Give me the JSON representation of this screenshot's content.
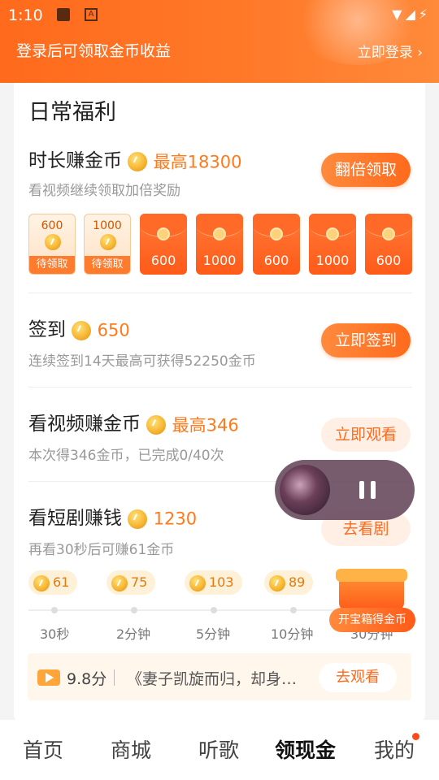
{
  "status_bar": {
    "time": "1:10",
    "icons": "▼◢⚡"
  },
  "header": {
    "login_prompt": "登录后可领取金币收益",
    "login_button": "立即登录 ›"
  },
  "daily": {
    "title": "日常福利",
    "duration": {
      "title": "时长赚金币",
      "max": "最高18300",
      "desc": "看视频继续领取加倍奖励",
      "button": "翻倍领取",
      "envelopes": [
        {
          "amount": "600",
          "state": "待领取"
        },
        {
          "amount": "1000",
          "state": "待领取"
        },
        {
          "amount": "600"
        },
        {
          "amount": "1000"
        },
        {
          "amount": "600"
        },
        {
          "amount": "1000"
        },
        {
          "amount": "600"
        }
      ]
    },
    "checkin": {
      "title": "签到",
      "coins": "650",
      "desc": "连续签到14天最高可获得52250金币",
      "button": "立即签到"
    },
    "video": {
      "title": "看视频赚金币",
      "max": "最高346",
      "desc": "本次得346金币，已完成0/40次",
      "button": "立即观看"
    },
    "drama": {
      "title": "看短剧赚钱",
      "coins": "1230",
      "desc": "再看30秒后可赚61金币",
      "button": "去看剧",
      "milestones": [
        {
          "coins": "61",
          "time": "30秒"
        },
        {
          "coins": "75",
          "time": "2分钟"
        },
        {
          "coins": "103",
          "time": "5分钟"
        },
        {
          "coins": "89",
          "time": "10分钟"
        },
        {
          "time": "30分钟"
        }
      ],
      "recommend": {
        "score": "9.8分",
        "title": "《妻子凯旋而归，却身…",
        "button": "去观看"
      }
    }
  },
  "chest": {
    "label": "开宝箱得金币"
  },
  "tabs": [
    "首页",
    "商城",
    "听歌",
    "领现金",
    "我的"
  ],
  "colors": {
    "accent": "#ff6a1c",
    "coin": "#f7b733"
  }
}
